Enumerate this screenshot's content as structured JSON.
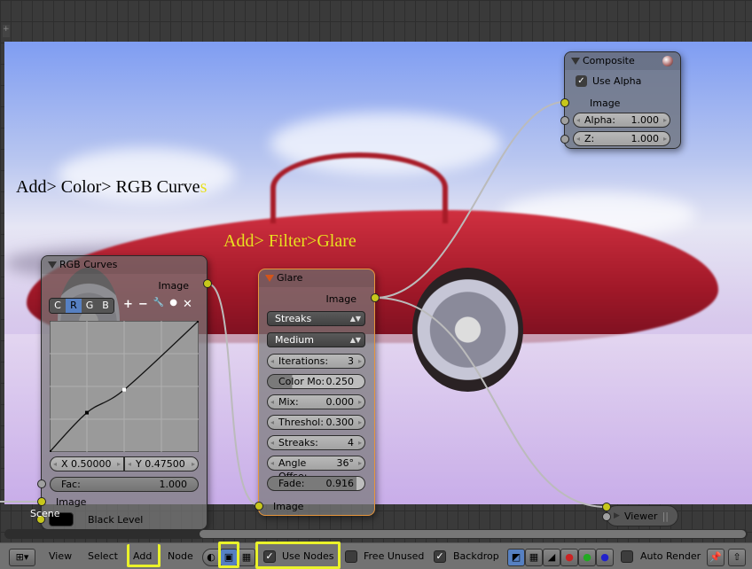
{
  "annotations": {
    "rgb_curves_main": "Add> Color> RGB Curve",
    "rgb_curves_last": "s",
    "glare": "Add> Filter>Glare"
  },
  "nodes": {
    "rgb_curves": {
      "title": "RGB Curves",
      "output": "Image",
      "channels": [
        "C",
        "R",
        "G",
        "B"
      ],
      "active_channel": "R",
      "tools": [
        "+",
        "−",
        "🔧",
        "●",
        "✕"
      ],
      "curve_points": [
        [
          0,
          0
        ],
        [
          0.25,
          0.3
        ],
        [
          0.5,
          0.475
        ],
        [
          1,
          1
        ]
      ],
      "x_label": "X 0.50000",
      "y_label": "Y 0.47500",
      "fac_label": "Fac:",
      "fac_value": "1.000",
      "input": "Image",
      "black_level": "Black Level"
    },
    "glare": {
      "title": "Glare",
      "output": "Image",
      "type": "Streaks",
      "quality": "Medium",
      "fields": [
        {
          "label": "Iterations:",
          "value": "3"
        },
        {
          "label": "Color Mo:",
          "value": "0.250",
          "fill": 0.25
        },
        {
          "label": "Mix:",
          "value": "0.000"
        },
        {
          "label": "Threshol:",
          "value": "0.300"
        },
        {
          "label": "Streaks:",
          "value": "4"
        },
        {
          "label": "Angle Offse:",
          "value": "36°"
        },
        {
          "label": "Fade:",
          "value": "0.916",
          "fill": 0.916
        }
      ],
      "input": "Image"
    },
    "composite": {
      "title": "Composite",
      "use_alpha": "Use Alpha",
      "input": "Image",
      "alpha_label": "Alpha:",
      "alpha_value": "1.000",
      "z_label": "Z:",
      "z_value": "1.000"
    },
    "viewer": {
      "title": "Viewer"
    }
  },
  "scene_label": "Scene",
  "header": {
    "menus": [
      "View",
      "Select",
      "Add",
      "Node"
    ],
    "use_nodes": "Use Nodes",
    "free_unused": "Free Unused",
    "backdrop": "Backdrop",
    "auto_render": "Auto Render",
    "use_nodes_checked": true,
    "backdrop_checked": true
  },
  "colors": {
    "highlight": "#eaf22a",
    "socket_image": "#c7c71c",
    "active_node": "#e8963c"
  }
}
